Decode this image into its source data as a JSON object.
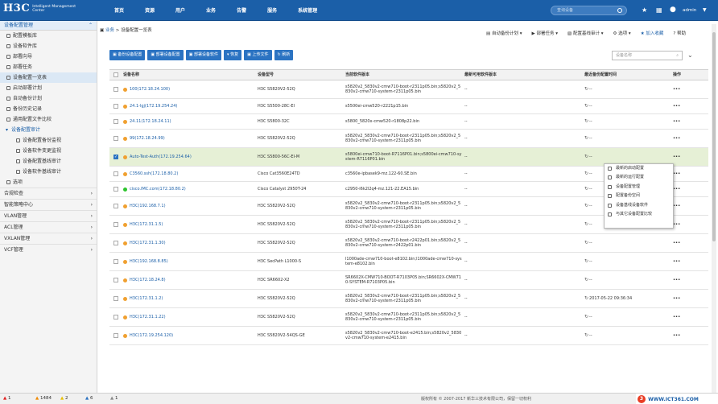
{
  "header": {
    "logo": "H3C",
    "logo_sub": "Intelligent Management Center",
    "nav": [
      "首页",
      "资源",
      "用户",
      "业务",
      "告警",
      "服务",
      "系统管理"
    ],
    "search_placeholder": "查询设备",
    "user": "admin"
  },
  "sidebar": {
    "title": "设备配置管理",
    "items": [
      {
        "label": "配置模板库",
        "level": 1
      },
      {
        "label": "设备软件库",
        "level": 1
      },
      {
        "label": "部署向导",
        "level": 1
      },
      {
        "label": "部署任务",
        "level": 1
      },
      {
        "label": "设备配置一览表",
        "level": 1,
        "active": true
      },
      {
        "label": "启动部署计划",
        "level": 1
      },
      {
        "label": "自动备份计划",
        "level": 1
      },
      {
        "label": "备份历史记录",
        "level": 1
      },
      {
        "label": "通用配置文件比较",
        "level": 1
      },
      {
        "label": "设备配置审计",
        "level": 0,
        "group": true
      },
      {
        "label": "设备配置备份监视",
        "level": 2
      },
      {
        "label": "设备软件变更监视",
        "level": 2
      },
      {
        "label": "设备配置基线审计",
        "level": 2
      },
      {
        "label": "设备软件基线审计",
        "level": 2
      },
      {
        "label": "选项",
        "level": 1
      }
    ],
    "sections": [
      "合规检查",
      "智能策略中心",
      "VLAN管理",
      "ACL管理",
      "VXLAN管理",
      "VCF管理"
    ]
  },
  "breadcrumb": {
    "root": "业务",
    "sep": " > ",
    "current": "设备配置一览表"
  },
  "actions": [
    "自动备份计划",
    "部署任务",
    "配置基线审计",
    "选项",
    "加入收藏",
    "帮助"
  ],
  "toolbar": [
    "备份设备配置",
    "部署设备配置",
    "部署设备软件",
    "恢复",
    "上传文件",
    "刷新"
  ],
  "filter_placeholder": "设备名称",
  "table": {
    "headers": [
      "设备名称",
      "设备型号",
      "当前软件版本",
      "最新可用软件版本",
      "最近备份配置时间",
      "操作"
    ],
    "rows": [
      {
        "status": "orange",
        "name": "100(172.18.24.100)",
        "model": "H3C S5820V2-52Q",
        "software": "s5820v2_5830v2-cmw710-boot-r2311p05.bin;s5820v2_5830v2-cmw710-system-r2311p05.bin",
        "latest": "--",
        "backup": "--",
        "checked": false
      },
      {
        "status": "orange",
        "name": "24.1-lgj(172.19.254.24)",
        "model": "H3C S5500-28C-EI",
        "software": "s5500ei-cmw520-r2221p15.bin",
        "latest": "--",
        "backup": "--",
        "checked": false
      },
      {
        "status": "orange",
        "name": "24.11(172.18.24.11)",
        "model": "H3C S5800-32C",
        "software": "s5800_5820x-cmw520-r1808p22.bin",
        "latest": "--",
        "backup": "--",
        "checked": false
      },
      {
        "status": "orange",
        "name": "99(172.18.24.99)",
        "model": "H3C S5820V2-52Q",
        "software": "s5820v2_5830v2-cmw710-boot-r2311p05.bin;s5820v2_5830v2-cmw710-system-r2311p05.bin",
        "latest": "--",
        "backup": "--",
        "checked": false
      },
      {
        "status": "orange",
        "name": "Auto-Test-Auth(172.19.254.64)",
        "model": "H3C S5800-56C-EI-M",
        "software": "s5800ei-cmw710-boot-R7116P01.bin;s5800ei-cmw710-system-R7116P01.bin",
        "latest": "--",
        "backup": "--",
        "checked": true
      },
      {
        "status": "orange",
        "name": "C3560.ssh(172.18.80.2)",
        "model": "Cisco Cat3560E24TD",
        "software": "c3560e-ipbasek9-mz.122-60.SE.bin",
        "latest": "--",
        "backup": "--",
        "checked": false
      },
      {
        "status": "green",
        "name": "cisco.IMC.com(172.18.80.2)",
        "model": "Cisco Catalyst 2950T-24",
        "software": "c2950-i6k2l2q4-mz.121-22.EA15.bin",
        "latest": "--",
        "backup": "--",
        "checked": false
      },
      {
        "status": "orange",
        "name": "H3C(192.168.7.1)",
        "model": "H3C S5820V2-52Q",
        "software": "s5820v2_5830v2-cmw710-boot-r2311p05.bin;s5820v2_5830v2-cmw710-system-r2311p05.bin",
        "latest": "--",
        "backup": "--",
        "checked": false
      },
      {
        "status": "orange",
        "name": "H3C(172.31.1.5)",
        "model": "H3C S5820V2-52Q",
        "software": "s5820v2_5830v2-cmw710-boot-r2311p05.bin;s5820v2_5830v2-cmw710-system-r2311p05.bin",
        "latest": "--",
        "backup": "--",
        "checked": false
      },
      {
        "status": "orange",
        "name": "H3C(172.31.1.30)",
        "model": "H3C S5820V2-52Q",
        "software": "s5820v2_5830v2-cmw710-boot-r2422p01.bin;s5820v2_5830v2-cmw710-system-r2422p01.bin",
        "latest": "--",
        "backup": "--",
        "checked": false
      },
      {
        "status": "orange",
        "name": "H3C(192.168.8.85)",
        "model": "H3C SecPath L1000-S",
        "software": "l1000ade-cmw710-boot-e8102.bin;l1000ade-cmw710-system-e8102.bin",
        "latest": "--",
        "backup": "--",
        "checked": false
      },
      {
        "status": "orange",
        "name": "H3C(172.18.24.8)",
        "model": "H3C SR6602-X2",
        "software": "SR6602X-CMW710-BOOT-R7103P05.bin;SR6602X-CMW710-SYSTEM-R7103P05.bin",
        "latest": "--",
        "backup": "--",
        "checked": false
      },
      {
        "status": "orange",
        "name": "H3C(172.31.1.2)",
        "model": "H3C S5820V2-52Q",
        "software": "s5820v2_5830v2-cmw710-boot-r2311p05.bin;s5820v2_5830v2-cmw710-system-r2311p05.bin",
        "latest": "--",
        "backup": "2017-05-22 09:36:34",
        "checked": false
      },
      {
        "status": "orange",
        "name": "H3C(172.31.1.22)",
        "model": "H3C S5820V2-52Q",
        "software": "s5820v2_5830v2-cmw710-boot-r2311p05.bin;s5820v2_5830v2-cmw710-system-r2311p05.bin",
        "latest": "--",
        "backup": "--",
        "checked": false
      },
      {
        "status": "orange",
        "name": "H3C(172.19.254.120)",
        "model": "H3C S5820V2-54QS-GE",
        "software": "s5820v2_5830v2-cmw710-boot-e2415.bin;s5820v2_5830v2-cmw710-system-e2415.bin",
        "latest": "--",
        "backup": "--",
        "checked": false
      }
    ]
  },
  "context_menu": [
    "最新的启动配置",
    "最新的运行配置",
    "设备配置管理",
    "配置备份空间",
    "设备基线设备软件",
    "与其它设备配置比较"
  ],
  "statusbar": {
    "alarms": [
      {
        "color": "#e02020",
        "count": "1"
      },
      {
        "color": "#f08a00",
        "count": "1484"
      },
      {
        "color": "#e8c000",
        "count": "2"
      },
      {
        "color": "#2b73c2",
        "count": "6"
      },
      {
        "color": "#888888",
        "count": "1"
      }
    ]
  },
  "copyright": "版权所有 © 2007-2017 新华三技术有限公司，保留一切权利",
  "watermark": "WWW.ICT361.COM"
}
